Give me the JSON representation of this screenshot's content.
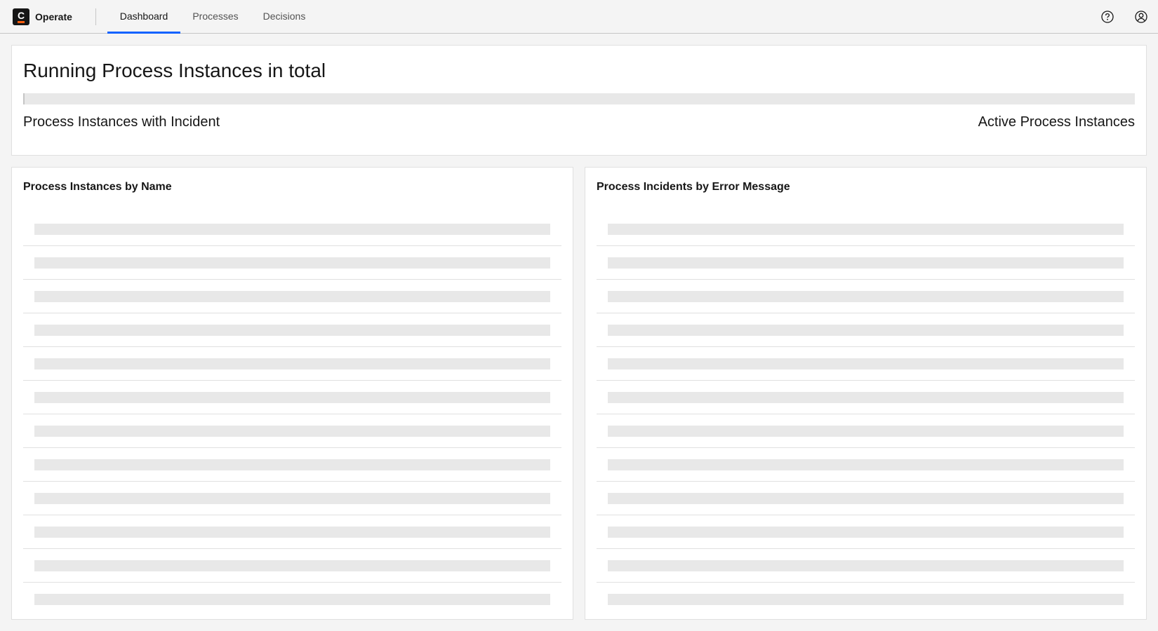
{
  "header": {
    "app_name": "Operate",
    "logo_letter": "C",
    "tabs": [
      {
        "label": "Dashboard",
        "active": true
      },
      {
        "label": "Processes",
        "active": false
      },
      {
        "label": "Decisions",
        "active": false
      }
    ],
    "icons": {
      "help": "help-circle-icon",
      "user": "user-avatar-icon"
    }
  },
  "summary": {
    "title": "Running Process Instances in total",
    "incident_label": "Process Instances with Incident",
    "active_label": "Active Process Instances",
    "incident_fraction": 0.001
  },
  "panels": {
    "by_name": {
      "title": "Process Instances by Name",
      "loading_rows": 12
    },
    "by_error": {
      "title": "Process Incidents by Error Message",
      "loading_rows": 12
    }
  },
  "colors": {
    "accent": "#0f62fe",
    "brand_orange": "#fc5d0d",
    "skeleton": "#e8e8e8"
  }
}
